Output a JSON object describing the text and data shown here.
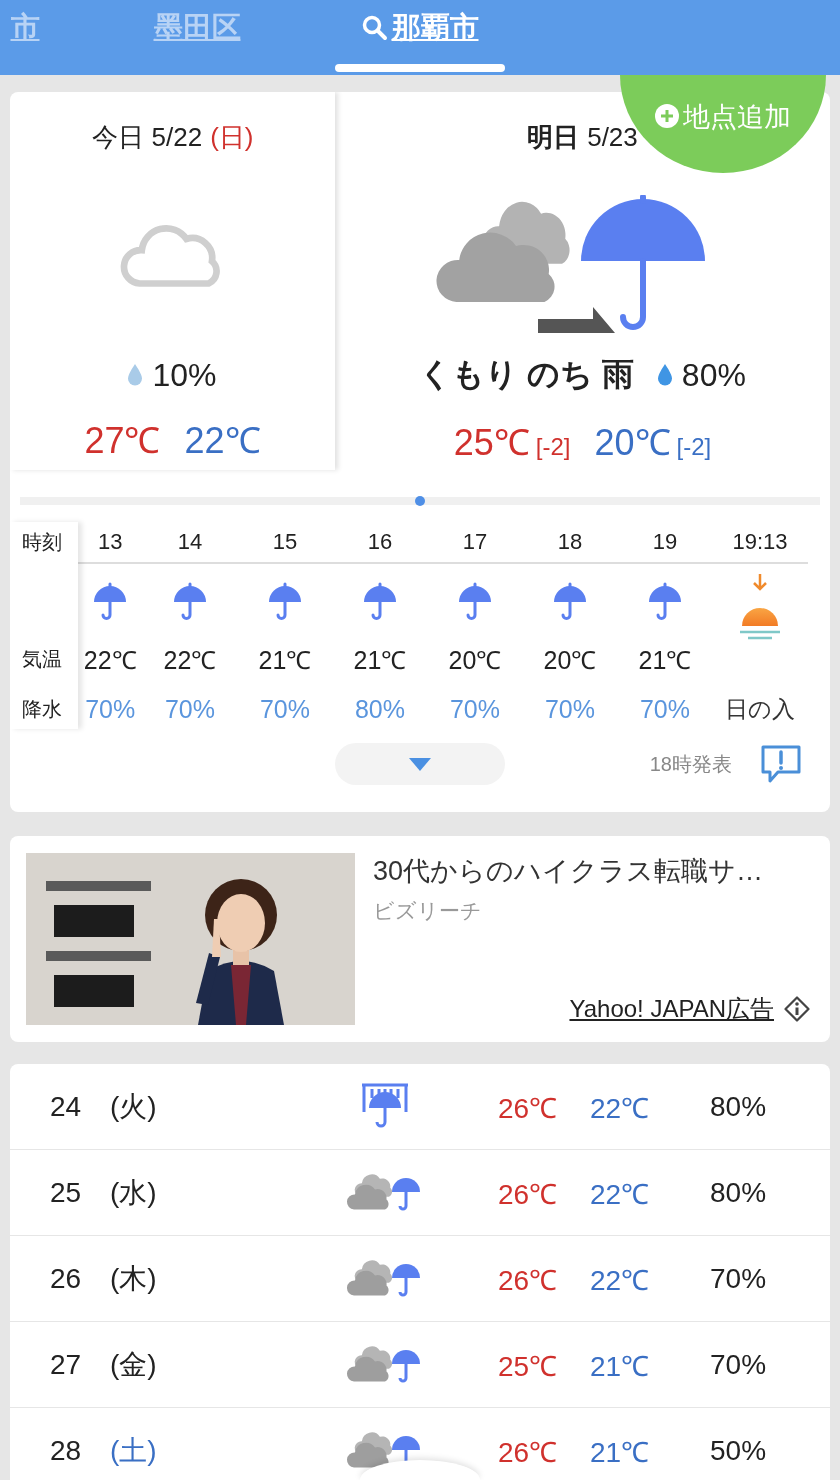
{
  "header": {
    "tabs": [
      {
        "label": "市",
        "selected": false,
        "search": false
      },
      {
        "label": "墨田区",
        "selected": false,
        "search": false
      },
      {
        "label": "那覇市",
        "selected": true,
        "search": true
      }
    ]
  },
  "add_location_button": {
    "label": "地点追加"
  },
  "today": {
    "label": "今日",
    "date": "5/22",
    "weekday": "(日)",
    "color": "#d0312d",
    "precip": "10%",
    "high": "27℃",
    "low": "22℃"
  },
  "tomorrow": {
    "label": "明日",
    "date": "5/23",
    "summary": "くもり のち 雨",
    "precip": "80%",
    "high": "25℃",
    "high_diff": "[-2]",
    "low": "20℃",
    "low_diff": "[-2]"
  },
  "hourly": {
    "labels": {
      "time": "時刻",
      "temp": "気温",
      "precip": "降水"
    },
    "columns": [
      {
        "kind": "rain",
        "time": "13",
        "temp": "22℃",
        "precip": "70%"
      },
      {
        "kind": "rain",
        "time": "14",
        "temp": "22℃",
        "precip": "70%"
      },
      {
        "kind": "rain",
        "time": "15",
        "temp": "21℃",
        "precip": "70%"
      },
      {
        "kind": "rain",
        "time": "16",
        "temp": "21℃",
        "precip": "80%"
      },
      {
        "kind": "rain",
        "time": "17",
        "temp": "20℃",
        "precip": "70%"
      },
      {
        "kind": "rain",
        "time": "18",
        "temp": "20℃",
        "precip": "70%"
      },
      {
        "kind": "rain",
        "time": "19",
        "temp": "21℃",
        "precip": "70%"
      },
      {
        "kind": "sunset",
        "time": "19:13",
        "caption": "日の入"
      }
    ],
    "issued": "18時発表"
  },
  "ad": {
    "title": "30代からのハイクラス転職サ…",
    "advertiser": "ビズリーチ",
    "label": "Yahoo! JAPAN広告"
  },
  "weekly": [
    {
      "kind": "heavy",
      "day": "24",
      "weekday": "(火)",
      "color": "#222222",
      "high": "26℃",
      "low": "22℃",
      "precip": "80%"
    },
    {
      "kind": "mixed",
      "day": "25",
      "weekday": "(水)",
      "color": "#222222",
      "high": "26℃",
      "low": "22℃",
      "precip": "80%"
    },
    {
      "kind": "mixed",
      "day": "26",
      "weekday": "(木)",
      "color": "#222222",
      "high": "26℃",
      "low": "22℃",
      "precip": "70%"
    },
    {
      "kind": "mixed",
      "day": "27",
      "weekday": "(金)",
      "color": "#222222",
      "high": "25℃",
      "low": "21℃",
      "precip": "70%"
    },
    {
      "kind": "mixed",
      "day": "28",
      "weekday": "(土)",
      "color": "#3a6fc4",
      "high": "26℃",
      "low": "21℃",
      "precip": "50%"
    }
  ]
}
